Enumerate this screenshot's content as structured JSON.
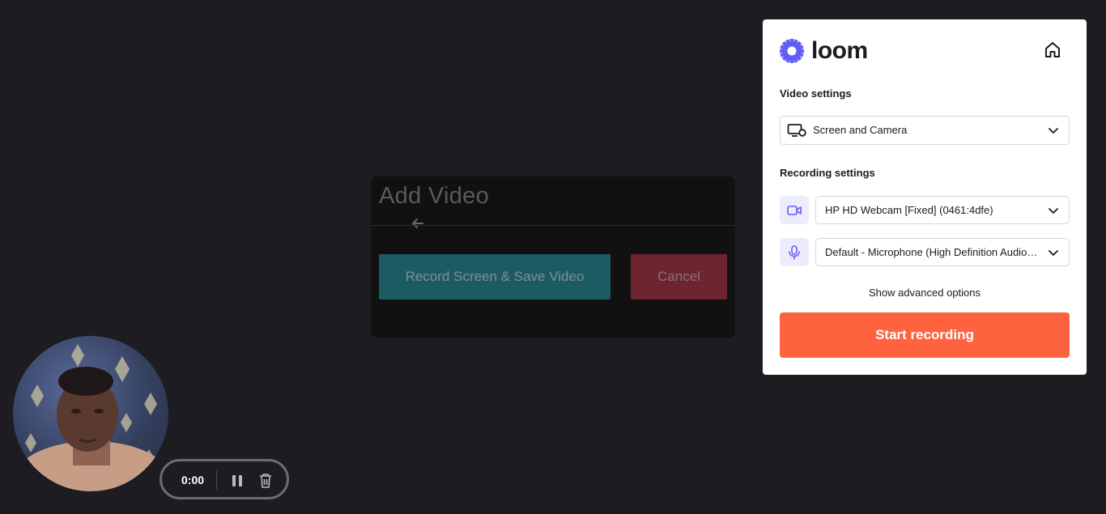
{
  "modal": {
    "title": "Add Video",
    "record_button": "Record Screen & Save Video",
    "cancel_button": "Cancel"
  },
  "recorder": {
    "time": "0:00"
  },
  "loom": {
    "brand": "loom",
    "video_settings_label": "Video settings",
    "video_mode": "Screen and Camera",
    "recording_settings_label": "Recording settings",
    "camera_device": "HP HD Webcam [Fixed] (0461:4dfe)",
    "microphone_device": "Default - Microphone (High Definition Audio Device)",
    "advanced_link": "Show advanced options",
    "start_button": "Start recording"
  },
  "colors": {
    "accent": "#625df5",
    "start": "#ff623e"
  }
}
